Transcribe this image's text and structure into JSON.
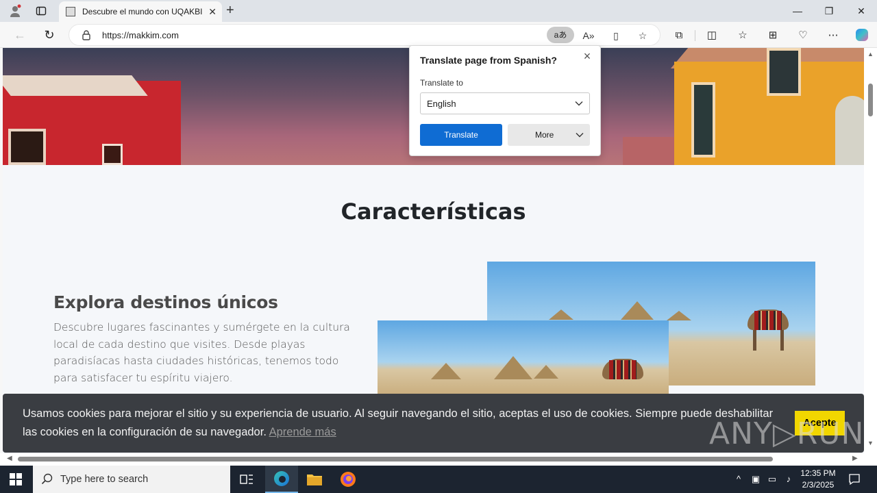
{
  "browser": {
    "tab_title": "Descubre el mundo con UQAKBI",
    "url": "https://makkim.com",
    "translate_pill": "aあ"
  },
  "translate_popup": {
    "title": "Translate page from Spanish?",
    "label": "Translate to",
    "selected_language": "English",
    "translate_button": "Translate",
    "more_button": "More"
  },
  "page": {
    "section_title": "Características",
    "feature_title": "Explora destinos únicos",
    "feature_text": "Descubre lugares fascinantes y sumérgete en la cultura local de cada destino que visites. Desde playas paradisíacas hasta ciudades históricas, tenemos todo para satisfacer tu espíritu viajero."
  },
  "cookie_banner": {
    "text": "Usamos cookies para mejorar el sitio y su experiencia de usuario. Al seguir navegando el sitio, aceptas el uso de cookies. Siempre puede deshabilitar las cookies en la configuración de su navegador.",
    "link": "Aprende más",
    "accept_button": "Acepte"
  },
  "watermark": "ANY▷RUN",
  "taskbar": {
    "search_placeholder": "Type here to search",
    "time": "12:35 PM",
    "date": "2/3/2025"
  },
  "colors": {
    "accent_blue": "#0f6cd3",
    "cookie_button": "#f1d600",
    "cookie_bg": "#3a3d42"
  }
}
